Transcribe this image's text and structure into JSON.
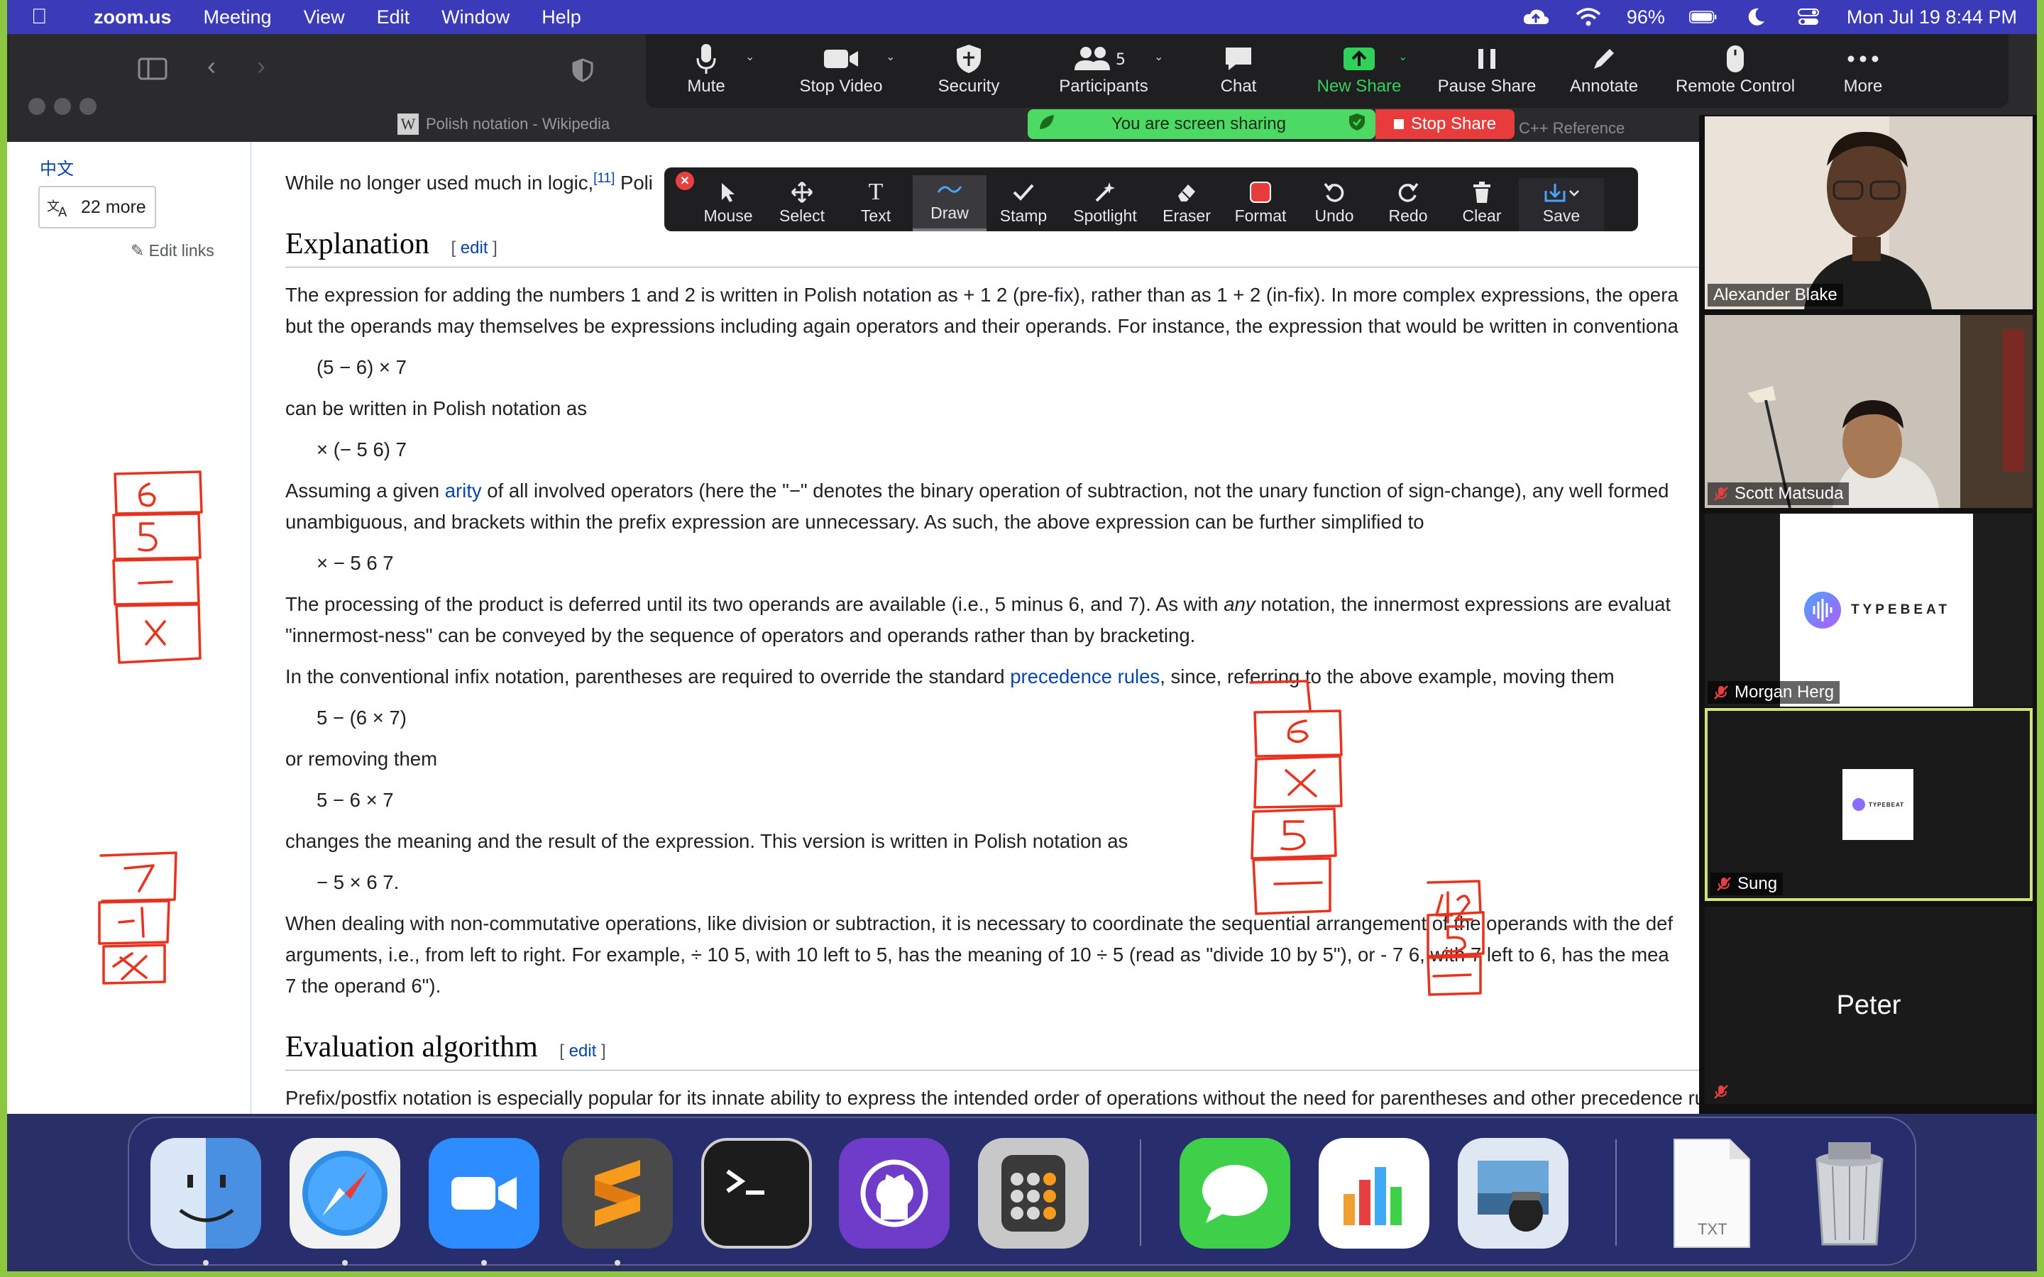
{
  "menubar": {
    "app_name": "zoom.us",
    "items": [
      "Meeting",
      "View",
      "Edit",
      "Window",
      "Help"
    ],
    "battery": "96%",
    "clock": "Mon Jul 19  8:44 PM"
  },
  "browser": {
    "tab_title": "Polish notation - Wikipedia",
    "tab_right": "C++ Reference"
  },
  "zoom_toolbar": {
    "buttons": [
      {
        "label": "Mute",
        "icon": "microphone-icon"
      },
      {
        "label": "Stop Video",
        "icon": "video-camera-icon"
      },
      {
        "label": "Security",
        "icon": "shield-icon"
      },
      {
        "label": "Participants",
        "icon": "people-icon",
        "count": "5"
      },
      {
        "label": "Chat",
        "icon": "chat-bubble-icon"
      },
      {
        "label": "New Share",
        "icon": "share-arrow-icon"
      },
      {
        "label": "Pause Share",
        "icon": "pause-icon"
      },
      {
        "label": "Annotate",
        "icon": "pencil-icon"
      },
      {
        "label": "Remote Control",
        "icon": "mouse-icon"
      },
      {
        "label": "More",
        "icon": "ellipsis-icon"
      }
    ],
    "share_status": "You are screen sharing",
    "stop_share": "Stop Share"
  },
  "annotate_toolbar": {
    "tools": [
      "Mouse",
      "Select",
      "Text",
      "Draw",
      "Stamp",
      "Spotlight",
      "Eraser",
      "Format",
      "Undo",
      "Redo",
      "Clear",
      "Save"
    ],
    "active": "Draw"
  },
  "sidebar": {
    "lang": "中文",
    "more_langs": "22 more",
    "edit_links": "Edit links"
  },
  "article": {
    "top_line_a": "While no longer used much in logic,",
    "top_line_ref": "[11]",
    "top_line_b": " Poli",
    "h_explanation": "Explanation",
    "edit_label": "edit",
    "p1a": "The expression for adding the numbers 1 and 2 is written in Polish notation as + 1 2 (pre-fix), rather than as 1 + 2 (in-fix). In more complex expressions, the opera",
    "p1b": "but the operands may themselves be expressions including again operators and their operands. For instance, the expression that would be written in conventiona",
    "ex1": "(5 − 6) × 7",
    "p2": "can be written in Polish notation as",
    "ex2": "× (− 5 6) 7",
    "p3a_1": "Assuming a given ",
    "p3a_link": "arity",
    "p3a_2": " of all involved operators (here the \"−\" denotes the binary operation of subtraction, not the unary function of sign-change), any well formed",
    "p3b": "unambiguous, and brackets within the prefix expression are unnecessary. As such, the above expression can be further simplified to",
    "ex3": "× − 5 6 7",
    "p4a_1": "The processing of the product is deferred until its two operands are available (i.e., 5 minus 6, and 7). As with ",
    "p4a_em": "any",
    "p4a_2": " notation, the innermost expressions are evaluat",
    "p4b": "\"innermost-ness\" can be conveyed by the sequence of operators and operands rather than by bracketing.",
    "p5_1": "In the conventional infix notation, parentheses are required to override the standard ",
    "p5_link": "precedence rules",
    "p5_2": ", since, referring to the above example, moving them",
    "ex4": "5 − (6 × 7)",
    "p6": "or removing them",
    "ex5": "5 − 6 × 7",
    "p7": "changes the meaning and the result of the expression. This version is written in Polish notation as",
    "ex6": "− 5 × 6 7.",
    "p8a": "When dealing with non-commutative operations, like division or subtraction, it is necessary to coordinate the sequential arrangement of the operands with the def",
    "p8b": "arguments, i.e., from left to right. For example, ÷ 10 5, with 10 left to 5, has the meaning of 10 ÷ 5 (read as \"divide 10 by 5\"), or - 7 6, with 7 left to 6, has the mea",
    "p8c": "7 the operand 6\").",
    "h_eval": "Evaluation algorithm",
    "p9": "Prefix/postfix notation is especially popular for its innate ability to express the intended order of operations without the need for parentheses and other precedence rules, as are usually employed"
  },
  "participants": [
    {
      "name": "Alexander Blake",
      "muted": false
    },
    {
      "name": "Scott Matsuda",
      "muted": true
    },
    {
      "name": "Morgan Herg",
      "muted": true,
      "logo": "TYPEBEAT"
    },
    {
      "name": "Sung",
      "muted": true,
      "logo": "TYPEBEAT"
    },
    {
      "name": "Peter",
      "muted": true
    }
  ],
  "ink": {
    "stack1": [
      "6",
      "5",
      "−",
      "×"
    ],
    "stack2": [
      "7",
      "−1",
      "×"
    ],
    "stack3": [
      "6",
      "×",
      "5",
      "−"
    ],
    "stack4": [
      "42",
      "5",
      "−"
    ]
  },
  "dock": {
    "apps": [
      "finder-icon",
      "safari-icon",
      "zoom-icon",
      "sublime-text-icon",
      "terminal-icon",
      "github-desktop-icon",
      "calculator-icon",
      "messages-icon",
      "numbers-icon",
      "preview-icon",
      "txt-file-icon",
      "trash-icon"
    ],
    "txt_label": "TXT"
  },
  "colors": {
    "menubar": "#3b3ab8",
    "ink": "#e8321e",
    "zoom_green": "#2fd15a",
    "wiki_link": "#0645ad"
  }
}
